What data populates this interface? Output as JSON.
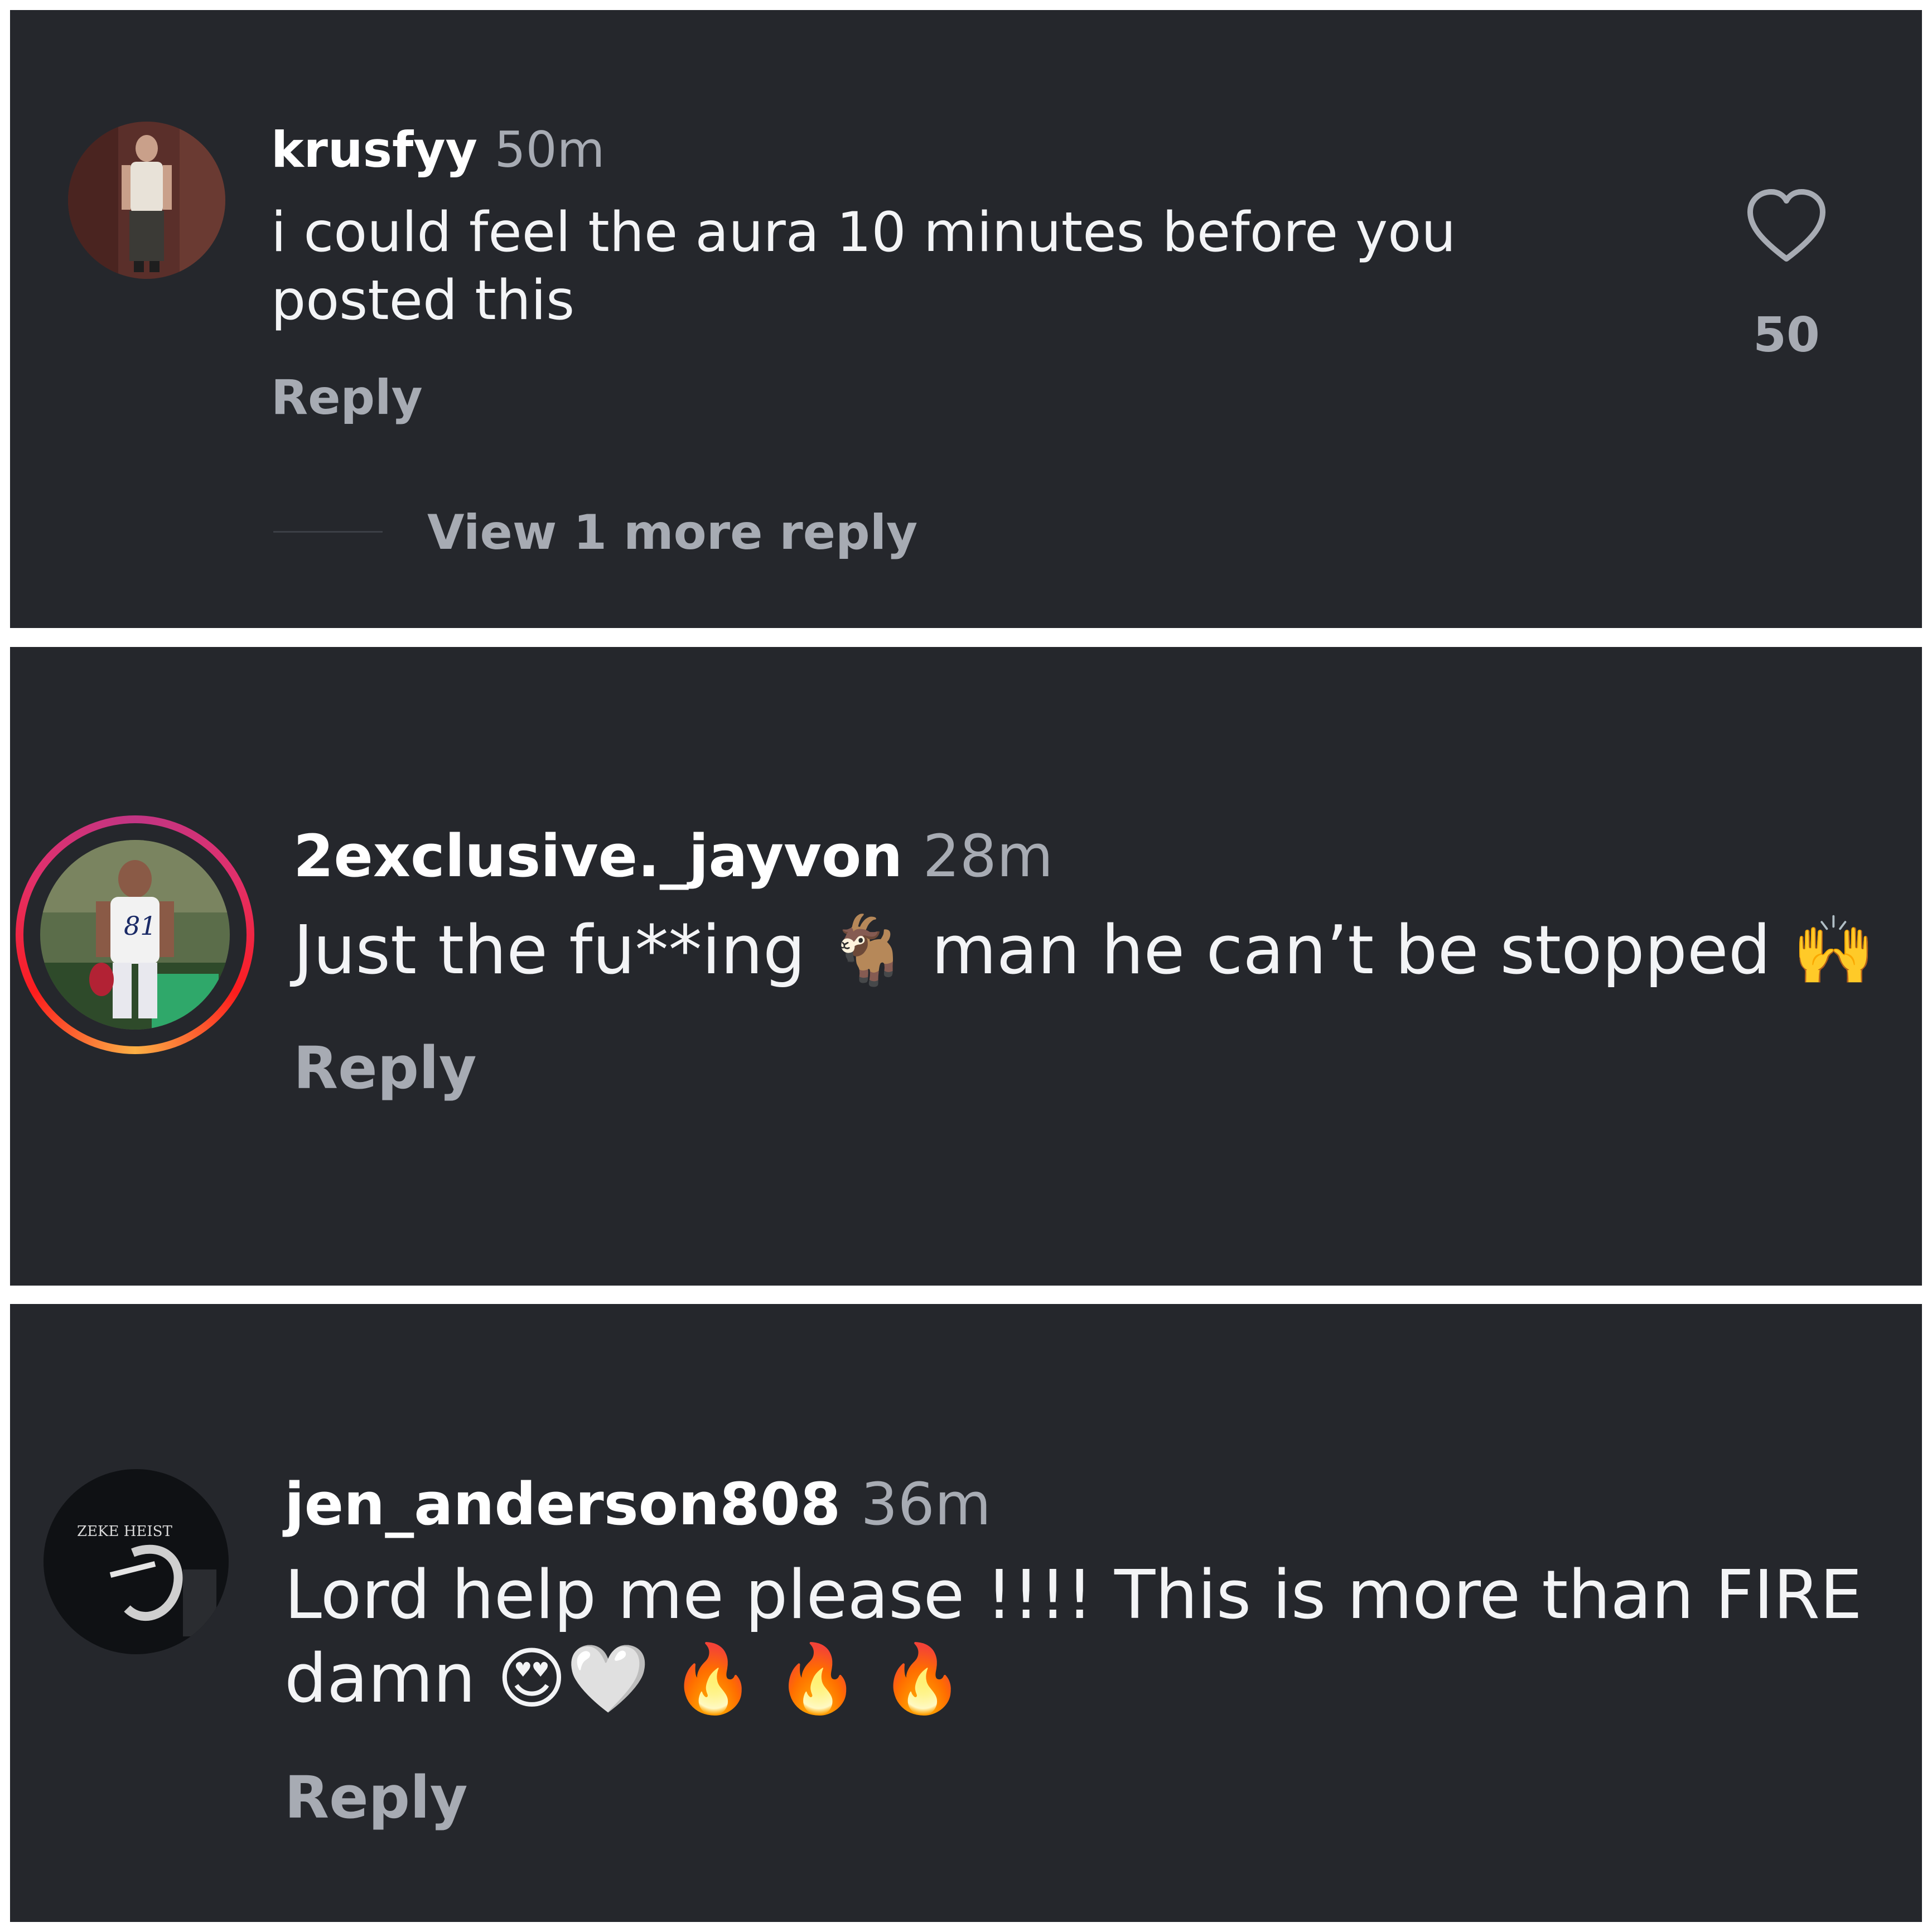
{
  "comments": [
    {
      "username": "krusfyy",
      "time": "50m",
      "text_line1": "i could feel the aura 10 minutes before you",
      "text_line2": "posted this",
      "reply_label": "Reply",
      "like_count": "50",
      "view_more_label": "View 1 more reply"
    },
    {
      "username": "2exclusive._jayvon",
      "time": "28m",
      "text_part1": "Just the fu**ing",
      "emoji1": "🐐",
      "text_part2": "man he can’t be stopped",
      "emoji2": "🙌",
      "reply_label": "Reply"
    },
    {
      "username": "jen_anderson808",
      "time": "36m",
      "text_line1": "Lord help me please !!!! This is more than FIRE",
      "text_line2": "damn",
      "emojis": "😍🤍 🔥 🔥 🔥",
      "reply_label": "Reply",
      "avatar_text": "ZEKE HEIST"
    }
  ],
  "colors": {
    "panel_bg": "#25272c",
    "primary_text": "#f3f4f6",
    "secondary_text": "#a7abb3",
    "story_ring": "#e1306c"
  },
  "icons": {
    "like": "heart-outline-icon"
  }
}
